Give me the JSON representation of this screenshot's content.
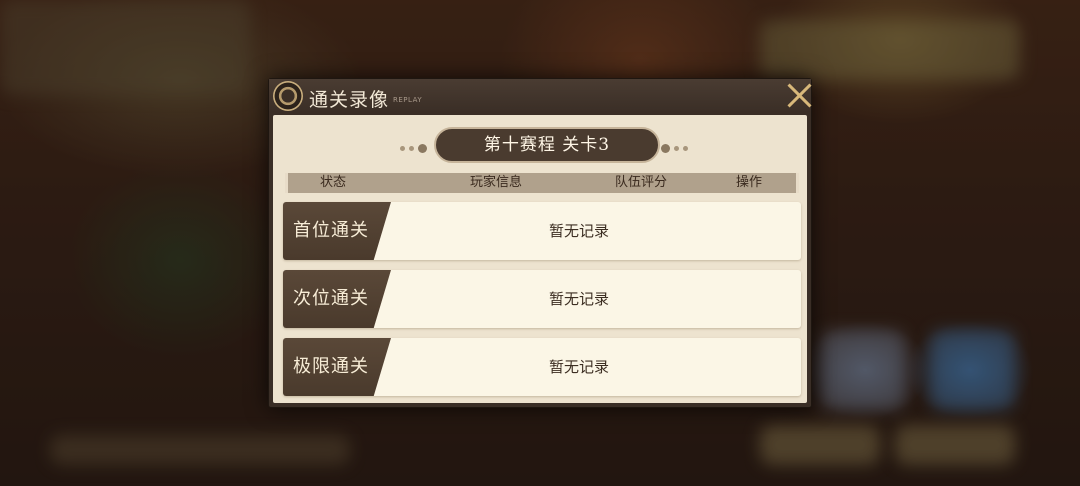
{
  "dialog": {
    "title": "通关录像",
    "subtitle": "REPLAY",
    "stage": "第十赛程 关卡3",
    "columns": [
      "状态",
      "玩家信息",
      "队伍评分",
      "操作"
    ],
    "records": [
      {
        "status": "首位通关",
        "content": "暂无记录"
      },
      {
        "status": "次位通关",
        "content": "暂无记录"
      },
      {
        "status": "极限通关",
        "content": "暂无记录"
      }
    ]
  },
  "colors": {
    "title_bar": "#3a2e26",
    "panel": "#ede3cf",
    "row": "#fbf6e6",
    "tag": "#4a3a2c",
    "close_icon": "#d8b87a"
  },
  "icons": [
    "emblem-icon",
    "close-icon"
  ]
}
